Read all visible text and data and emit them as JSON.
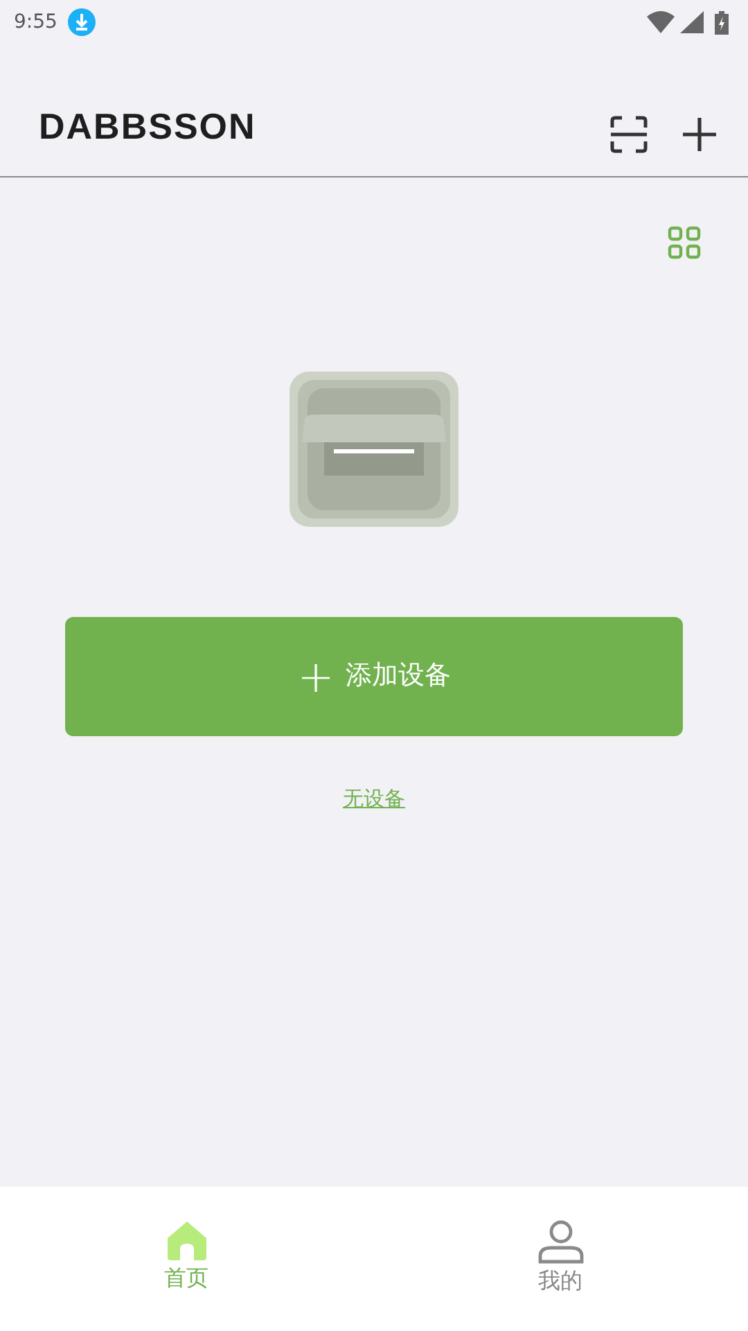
{
  "status_bar": {
    "time": "9:55"
  },
  "header": {
    "logo": "DABBSSON"
  },
  "add_button": {
    "icon": "+",
    "label": "添加设备"
  },
  "empty_link": "无设备",
  "bottom_nav": [
    {
      "kind": "home",
      "label": "首页",
      "selected": true
    },
    {
      "kind": "profile",
      "label": "我的",
      "selected": false
    }
  ]
}
